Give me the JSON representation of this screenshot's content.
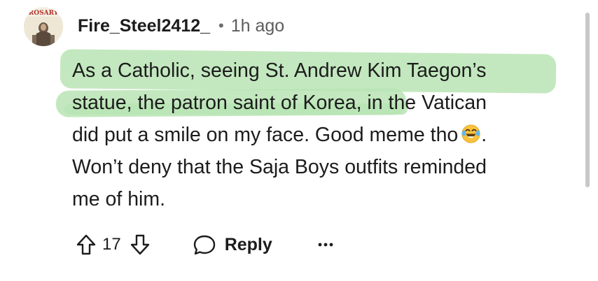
{
  "comment": {
    "avatar": {
      "badge_text": "ROSARY",
      "icon": "profile-avatar"
    },
    "author": "Fire_Steel2412_",
    "separator": "•",
    "timestamp": "1h ago",
    "body_lines": [
      "As a Catholic, seeing St. Andrew Kim Taegon’s",
      "statue, the patron saint of Korea, in the Vatican",
      "did put a smile on my face. Good meme tho",
      "Won’t deny that the Saja Boys outfits reminded",
      "me of him."
    ],
    "emoji": "tears-of-joy-emoji",
    "emoji_trailing": ".",
    "highlight_color": "#b9e4b4",
    "actions": {
      "upvote_icon": "arrow-up-icon",
      "vote_count": "17",
      "downvote_icon": "arrow-down-icon",
      "reply_icon": "speech-bubble-icon",
      "reply_label": "Reply",
      "more_icon": "ellipsis-icon"
    }
  }
}
